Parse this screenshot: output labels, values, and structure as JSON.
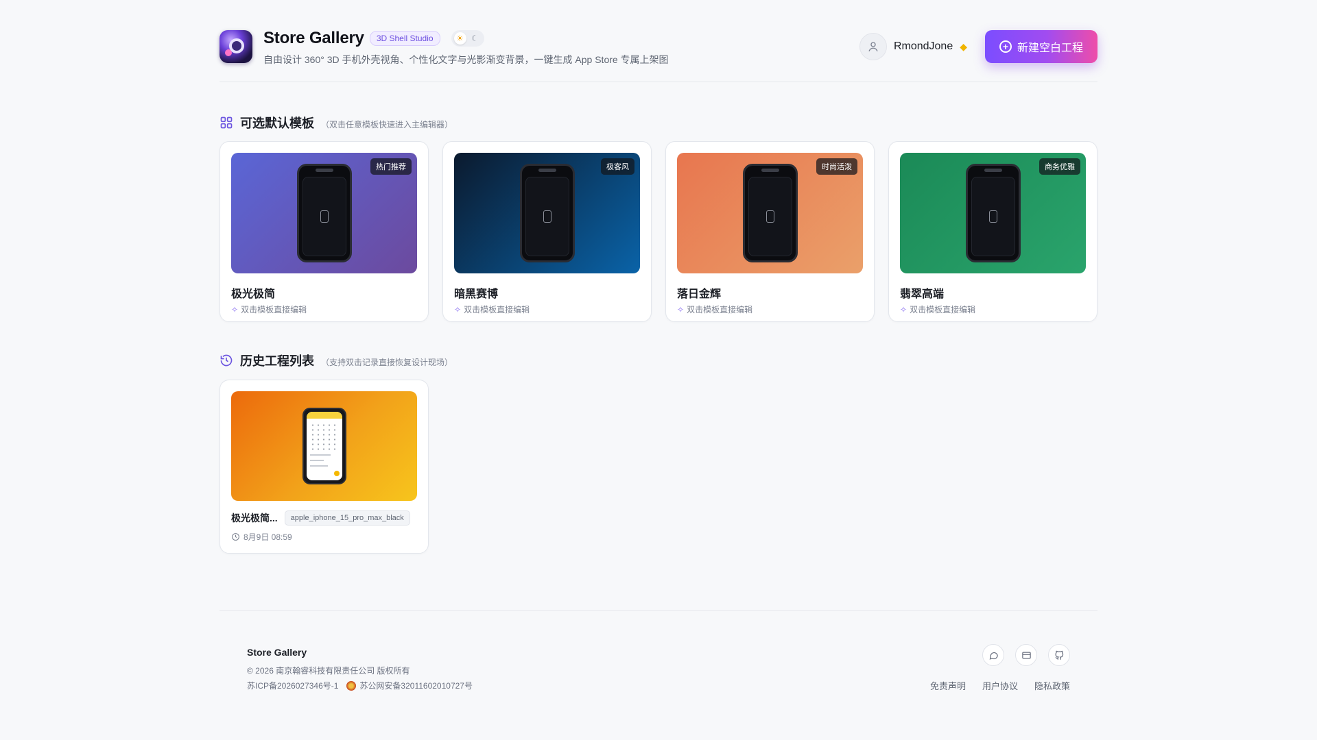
{
  "header": {
    "title": "Store Gallery",
    "badge": "3D Shell Studio",
    "subtitle": "自由设计 360° 3D 手机外壳视角、个性化文字与光影渐变背景，一键生成 App Store 专属上架图",
    "username": "RmondJone",
    "new_button": "新建空白工程"
  },
  "templates_section": {
    "title": "可选默认模板",
    "hint": "（双击任意模板快速进入主编辑器）",
    "items": [
      {
        "name": "极光极简",
        "tag": "热门推荐",
        "sub": "双击模板直接编辑",
        "gradient": [
          "#5a66d6",
          "#6c4a9e"
        ]
      },
      {
        "name": "暗黑赛博",
        "tag": "极客风",
        "sub": "双击模板直接编辑",
        "gradient": [
          "#0b1a2e",
          "#0a63a8"
        ]
      },
      {
        "name": "落日金辉",
        "tag": "时尚活泼",
        "sub": "双击模板直接编辑",
        "gradient": [
          "#e8764f",
          "#eaa06a"
        ]
      },
      {
        "name": "翡翠高端",
        "tag": "商务优雅",
        "sub": "双击模板直接编辑",
        "gradient": [
          "#1b8a57",
          "#2aa46c"
        ]
      }
    ]
  },
  "history_section": {
    "title": "历史工程列表",
    "hint": "（支持双击记录直接恢复设计现场）",
    "items": [
      {
        "name": "极光极简...",
        "device": "apple_iphone_15_pro_max_black",
        "time": "8月9日 08:59"
      }
    ]
  },
  "footer": {
    "brand": "Store Gallery",
    "copyright": "© 2026 南京翰睿科技有限责任公司 版权所有",
    "icp": "苏ICP备2026027346号-1",
    "police": "苏公网安备32011602010727号",
    "links": [
      "免责声明",
      "用户协议",
      "隐私政策"
    ]
  },
  "colors": {
    "accent": "#7b4dff",
    "accent_pink": "#ee4da9"
  }
}
